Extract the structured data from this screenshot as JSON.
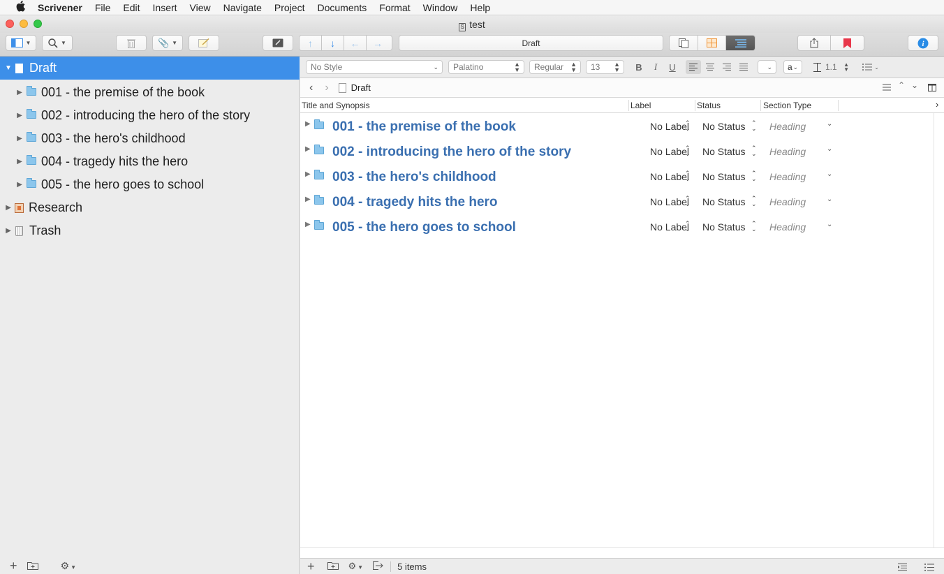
{
  "menubar": {
    "apple": "",
    "items": [
      "Scrivener",
      "File",
      "Edit",
      "Insert",
      "View",
      "Navigate",
      "Project",
      "Documents",
      "Format",
      "Window",
      "Help"
    ]
  },
  "window": {
    "title": "test",
    "doc_icon": "S"
  },
  "toolbar": {
    "draft_label": "Draft"
  },
  "binder": {
    "draft": "Draft",
    "items": [
      "001 - the premise of the book",
      "002 - introducing the hero of the story",
      "003 - the hero's childhood",
      "004 - tragedy hits the hero",
      "005 - the hero goes to school"
    ],
    "research": "Research",
    "trash": "Trash"
  },
  "format": {
    "style": "No Style",
    "font": "Palatino",
    "weight": "Regular",
    "size": "13",
    "bold": "B",
    "italic": "I",
    "underline": "U",
    "char_a": "a",
    "line_spacing": "1.1"
  },
  "nav": {
    "doc_title": "Draft"
  },
  "outline": {
    "columns": [
      "Title and Synopsis",
      "Label",
      "Status",
      "Section Type"
    ],
    "rows": [
      {
        "title": "001 - the premise of the book",
        "label": "No Label",
        "status": "No Status",
        "section_type": "Heading"
      },
      {
        "title": "002 - introducing the hero of the story",
        "label": "No Label",
        "status": "No Status",
        "section_type": "Heading"
      },
      {
        "title": "003 - the hero's childhood",
        "label": "No Label",
        "status": "No Status",
        "section_type": "Heading"
      },
      {
        "title": "004 - tragedy hits the hero",
        "label": "No Label",
        "status": "No Status",
        "section_type": "Heading"
      },
      {
        "title": "005 - the hero goes to school",
        "label": "No Label",
        "status": "No Status",
        "section_type": "Heading"
      }
    ]
  },
  "footer": {
    "items_count": "5 items"
  },
  "colors": {
    "selection": "#3d8fe9",
    "title_blue": "#3a6fb0",
    "folder": "#8cc6ec",
    "bookmark": "#e8374a",
    "info": "#2a8ce6",
    "grid_orange": "#f0953a"
  }
}
